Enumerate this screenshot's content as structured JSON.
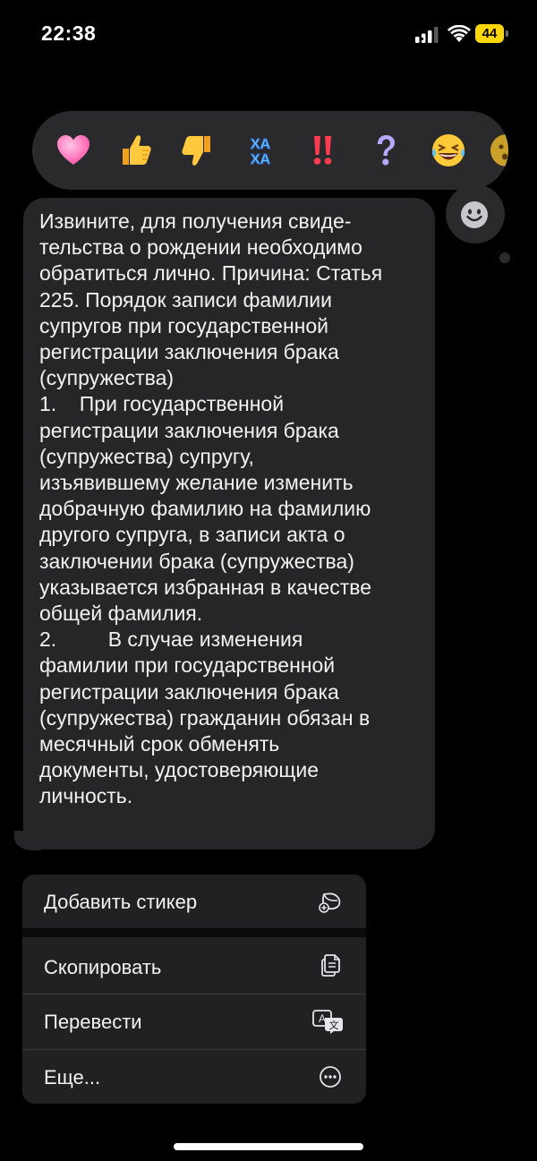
{
  "status_bar": {
    "time": "22:38",
    "battery": "44"
  },
  "reactions": [
    "heart",
    "thumbs-up",
    "thumbs-down",
    "haha",
    "double-exclamation",
    "question",
    "laughing-face",
    "partial-face"
  ],
  "message": {
    "text": "Извините, для получения свиде-\nтельства о рождении необходимо\nобратиться лично. Причина: Статья\n225. Порядок записи фамилии\nсупругов при государственной\nрегистрации заключения брака\n(супружества)\n1.    При государственной\nрегистрации заключения брака\n(супружества) супругу,\nизъявившему желание изменить\nдобрачную фамилию на фамилию\nдругого супруга, в записи акта о\nзаключении брака (супружества)\nуказывается избранная в качестве\nобщей фамилия.\n2.         В случае изменения\nфамилии при государственной\nрегистрации заключения брака\n(супружества) гражданин обязан в\nмесячный срок обменять\nдокументы, удостоверяющие\nличность."
  },
  "menu": {
    "items": [
      {
        "label": "Добавить стикер",
        "icon": "sticker-add-icon"
      },
      {
        "label": "Скопировать",
        "icon": "copy-icon"
      },
      {
        "label": "Перевести",
        "icon": "translate-icon"
      },
      {
        "label": "Еще...",
        "icon": "more-icon"
      }
    ]
  },
  "colors": {
    "battery": "#ffd60a",
    "bubble": "#262628",
    "menu": "#212123"
  }
}
